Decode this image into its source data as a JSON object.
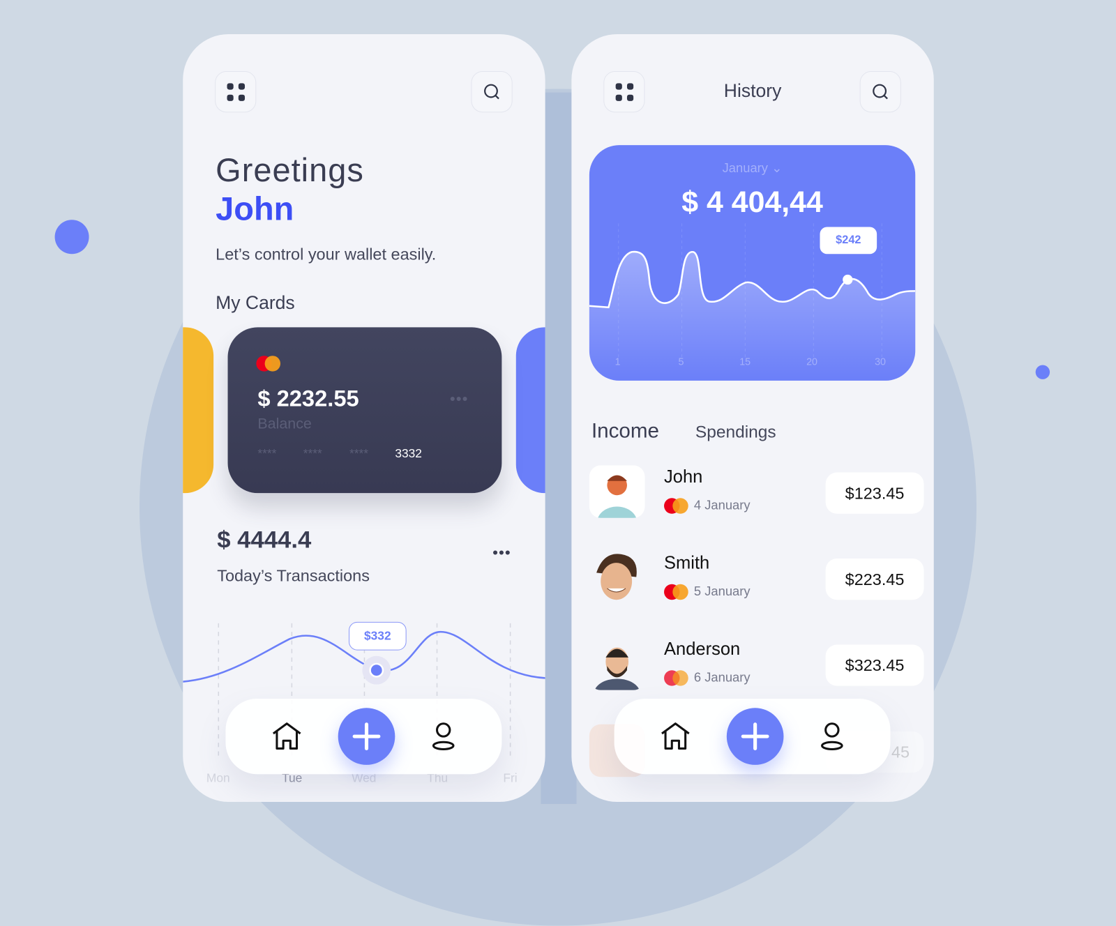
{
  "colors": {
    "accent": "#6b7ff9",
    "name_accent": "#3d4ef5",
    "card_dark": "#3b3e58",
    "yellow": "#f5b82e"
  },
  "home": {
    "menu_icon": "grid-icon",
    "search_icon": "search-icon",
    "greeting": "Greetings",
    "name": "John",
    "subtitle": "Let’s control your wallet easily.",
    "cards_title": "My Cards",
    "card": {
      "balance": "$ 2232.55",
      "balance_label": "Balance",
      "masked": [
        "****",
        "****",
        "****"
      ],
      "last4": "3332"
    },
    "total": "$ 4444.4",
    "total_label": "Today’s Transactions",
    "chart": {
      "days": [
        "Mon",
        "Tue",
        "Wed",
        "Thu",
        "Fri"
      ],
      "tooltip": "$332",
      "selected_day": "Wed"
    },
    "nav": {
      "home": "home-icon",
      "add": "plus-icon",
      "profile": "user-icon"
    }
  },
  "history": {
    "title": "History",
    "month": "January",
    "total": "$ 4 404,44",
    "chart": {
      "ticks": [
        "1",
        "5",
        "15",
        "20",
        "30"
      ],
      "tooltip": "$242"
    },
    "tabs": [
      {
        "label": "Income",
        "active": true
      },
      {
        "label": "Spendings",
        "active": false
      }
    ],
    "items": [
      {
        "name": "John",
        "date": "4 January",
        "amount": "$123.45"
      },
      {
        "name": "Smith",
        "date": "5 January",
        "amount": "$223.45"
      },
      {
        "name": "Anderson",
        "date": "6 January",
        "amount": "$323.45"
      },
      {
        "name": "",
        "date": "",
        "amount": "45"
      }
    ]
  }
}
